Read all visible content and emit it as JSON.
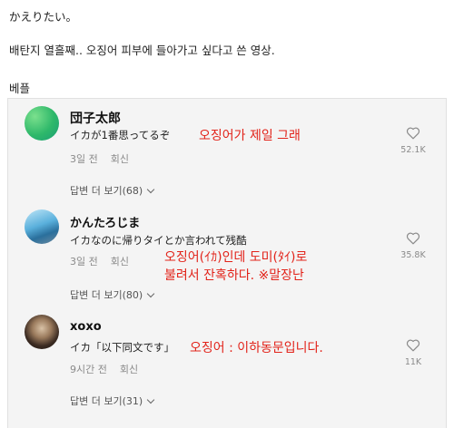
{
  "post": {
    "line1": "かえりたい。",
    "line2": "배탄지 열흘째.. 오징어 피부에 들아가고 싶다고 쓴 영상.",
    "line3": "베플"
  },
  "comments": [
    {
      "user": "団子太郎",
      "text": "イカが1番思ってるぞ",
      "annotation": "오징어가 제일 그래",
      "time": "3일 전",
      "reply": "회신",
      "more": "답변 더 보기(68)",
      "likes": "52.1K"
    },
    {
      "user": "かんたろじま",
      "text": "イカなのに帰りタイとか言われて残酷",
      "annotation_line1": "오징어(ｲｶ)인데 도미(ﾀｲ)로",
      "annotation_line2": "불려서 잔혹하다.   ※말장난",
      "time": "3일 전",
      "reply": "회신",
      "more": "답변 더 보기(80)",
      "likes": "35.8K"
    },
    {
      "user": "xoxo",
      "text": "イカ「以下同文です」",
      "annotation": "오징어 : 이하동문입니다.",
      "time": "9시간 전",
      "reply": "회신",
      "more": "답변 더 보기(31)",
      "likes": "11K"
    }
  ],
  "colors": {
    "annotation": "#e2231a",
    "panel_bg": "#f4f4f4",
    "meta": "#8a8a8a"
  }
}
